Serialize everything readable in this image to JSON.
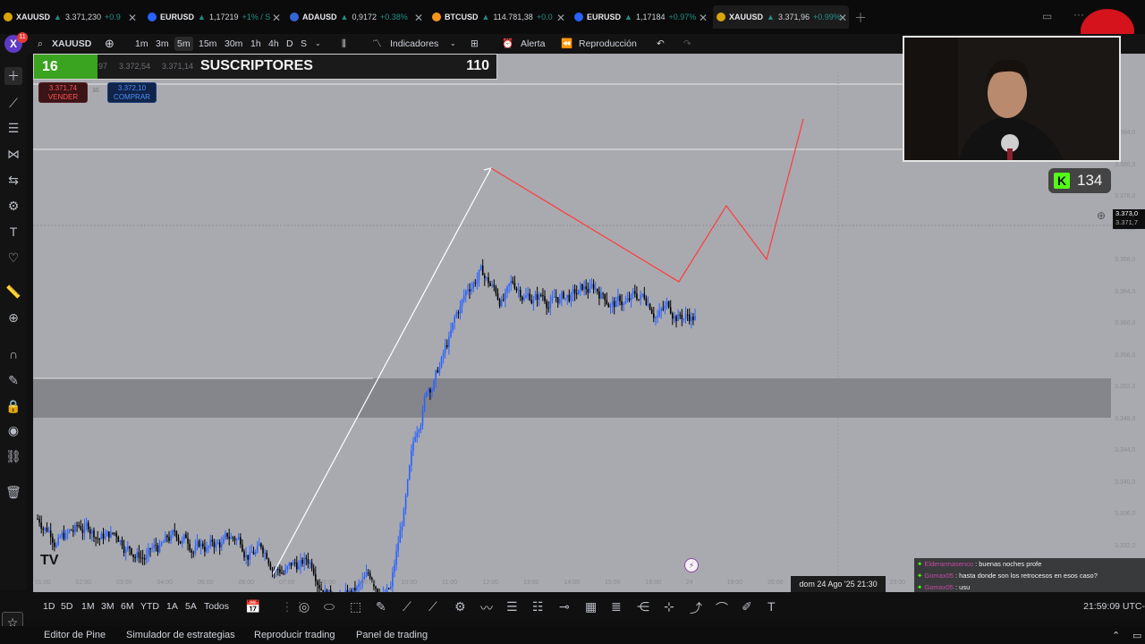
{
  "tabs": [
    {
      "symbol": "XAUUSD",
      "price": "3.371,230",
      "change": "+0.9",
      "color": "#d8a40b",
      "active": false
    },
    {
      "symbol": "EURUSD",
      "price": "1,17219",
      "change": "+1% / S",
      "color": "#2962ff",
      "active": false
    },
    {
      "symbol": "ADAUSD",
      "price": "0,9172",
      "change": "+0.38%",
      "color": "#3465d8",
      "active": false
    },
    {
      "symbol": "BTCUSD",
      "price": "114.781,38",
      "change": "+0.0",
      "color": "#f7931a",
      "active": false
    },
    {
      "symbol": "EURUSD",
      "price": "1,17184",
      "change": "+0.97%",
      "color": "#2962ff",
      "active": false
    },
    {
      "symbol": "XAUUSD",
      "price": "3.371,96",
      "change": "+0.99%",
      "color": "#d8a40b",
      "active": true
    }
  ],
  "toolbar": {
    "logo": "X",
    "badge": "11",
    "symbol": "XAUUSD",
    "intervals": [
      "1m",
      "3m",
      "5m",
      "15m",
      "30m",
      "1h",
      "4h",
      "D",
      "S"
    ],
    "selected_interval": "5m",
    "indicators": "Indicadores",
    "alert": "Alerta",
    "replay": "Reproducción"
  },
  "overlay": {
    "subs_count": "16",
    "subs_label": "SUSCRIPTORES",
    "subs_goal": "110",
    "faint_a": "97",
    "faint_b": "3.372,54",
    "faint_c": "3.371,14",
    "sell_price": "3.371,74",
    "sell_label": "VENDER",
    "spread": "36",
    "buy_price": "3.372,10",
    "buy_label": "COMPRAR",
    "kick_count": "134",
    "cross_price_a": "3.373,0",
    "cross_price_b": "3.371,7"
  },
  "chart_data": {
    "type": "candlestick",
    "symbol": "XAUUSD",
    "interval": "5m",
    "y_tick_labels": [
      "3.384,0",
      "3.380,0",
      "3.376,0",
      "3.372,0",
      "3.368,0",
      "3.364,0",
      "3.360,0",
      "3.356,0",
      "3.352,0",
      "3.348,0",
      "3.344,0",
      "3.340,0",
      "3.336,0",
      "3.332,0"
    ],
    "x_tick_labels": [
      "01:00",
      "02:00",
      "03:00",
      "04:00",
      "05:00",
      "06:00",
      "07:00",
      "08:00",
      "09:00",
      "10:00",
      "11:00",
      "12:00",
      "13:00",
      "14:00",
      "15:00",
      "16:00",
      "24",
      "19:00",
      "20:00",
      "21:00",
      "22:00",
      "23:00"
    ],
    "ylim": [
      3330,
      3386
    ],
    "grid": false,
    "crosshair_date": "dom 24 Ago '25   21:30"
  },
  "chat": [
    {
      "user": "Elderarmasenco",
      "message": ": buenas noches profe"
    },
    {
      "user": "Gomax05",
      "message": ": hasta donde son los retrocesos en esos caso?"
    },
    {
      "user": "Gomax05",
      "message": ": usu"
    }
  ],
  "ranges": [
    "1D",
    "5D",
    "1M",
    "3M",
    "6M",
    "YTD",
    "1A",
    "5A",
    "Todos"
  ],
  "clock": "21:59:09 UTC-",
  "footer": [
    "Editor de Pine",
    "Simulador de estrategias",
    "Reproducir trading",
    "Panel de trading"
  ]
}
